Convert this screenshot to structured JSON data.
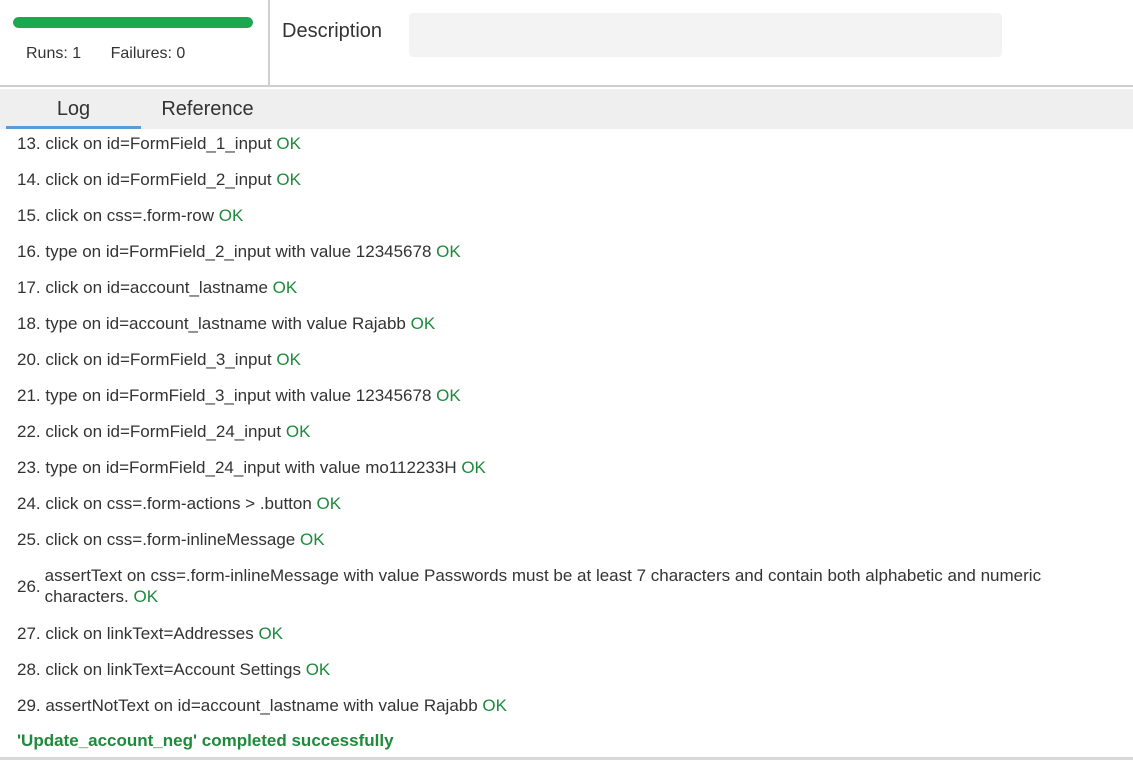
{
  "stats": {
    "progress_fraction": 1.0,
    "progress_color": "#1da84f",
    "runs_label": "Runs: 1",
    "failures_label": "Failures: 0"
  },
  "description": {
    "label": "Description",
    "value": ""
  },
  "tabs": [
    {
      "label": "Log",
      "active": true
    },
    {
      "label": "Reference",
      "active": false
    }
  ],
  "log": {
    "ok_label": "OK",
    "entries": [
      {
        "text": "13. click on id=FormField_1_input"
      },
      {
        "text": "14. click on id=FormField_2_input"
      },
      {
        "text": "15. click on css=.form-row"
      },
      {
        "text": "16. type on id=FormField_2_input with value 12345678"
      },
      {
        "text": "17. click on id=account_lastname"
      },
      {
        "text": "18. type on id=account_lastname with value Rajabb"
      },
      {
        "text": "20. click on id=FormField_3_input"
      },
      {
        "text": "21. type on id=FormField_3_input with value 12345678"
      },
      {
        "text": "22. click on id=FormField_24_input"
      },
      {
        "text": "23. type on id=FormField_24_input with value mo112233H"
      },
      {
        "text": "24. click on css=.form-actions > .button"
      },
      {
        "text": "25. click on css=.form-inlineMessage"
      },
      {
        "num": "26.",
        "text": "assertText on css=.form-inlineMessage with value Passwords must be at least 7 characters and contain both alphabetic and numeric characters."
      },
      {
        "text": "27. click on linkText=Addresses"
      },
      {
        "text": "28. click on linkText=Account Settings"
      },
      {
        "text": "29. assertNotText on id=account_lastname with value Rajabb"
      }
    ],
    "completion": "'Update_account_neg' completed successfully"
  }
}
